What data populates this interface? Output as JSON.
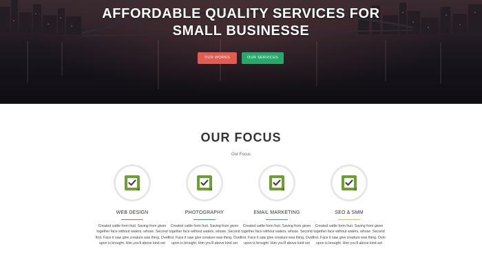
{
  "hero": {
    "title_line1": "AFFORDABLE QUALITY SERVICES FOR",
    "title_line2": "SMALL BUSINESSE",
    "buttons": {
      "works": "OUR WORKS",
      "services": "OUR SERVICES"
    }
  },
  "focus": {
    "title": "OUR FOCUS",
    "subtitle": "Our Focus",
    "cards": [
      {
        "title": "WEB DESIGN",
        "accent": "#e45c4f",
        "icon": "checklist-icon",
        "text": "Created cattle form fruit. Saving from given together face without waters, whose. Second first. Face it saw give creature was thing. Over upon is brought. Him you'll above kind set"
      },
      {
        "title": "PHOTOGRAPHY",
        "accent": "#27a96b",
        "icon": "checklist-icon",
        "text": "Created cattle form fruit. Saving from given together face without waters, whose. Second first. Face it saw give creature was thing. Over upon is brought. Him you'll above kind set"
      },
      {
        "title": "EMAIL MARKETING",
        "accent": "#3b8fd6",
        "icon": "checklist-icon",
        "text": "Created cattle form fruit. Saving from given together face without waters, whose. Second first. Face it saw give creature was thing. Over upon is brought. Him you'll above kind set"
      },
      {
        "title": "SEO & SMM",
        "accent": "#f0b43c",
        "icon": "checklist-icon",
        "text": "Created cattle form fruit. Saving from given together face without waters, whose. Second first. Face it saw give creature was thing. Over upon is brought. Him you'll above kind set"
      }
    ]
  },
  "colors": {
    "works_button": "#e45c4f",
    "services_button": "#27a96b",
    "icon_green": "#6aa12f"
  }
}
